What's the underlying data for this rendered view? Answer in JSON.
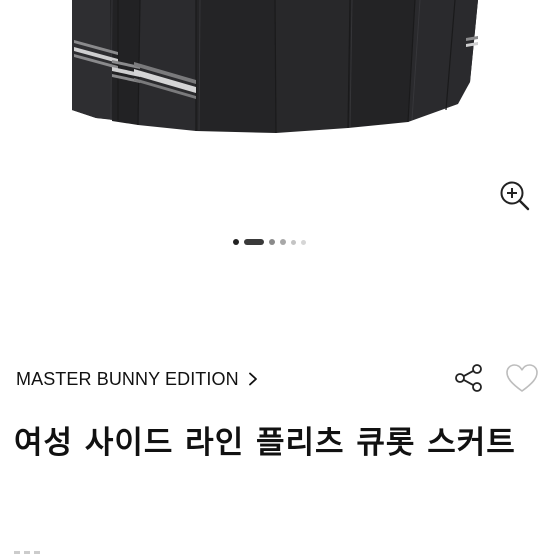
{
  "product": {
    "image_alt": "pleated skirt product photo",
    "carousel": {
      "total": 6,
      "active_index": 1
    },
    "zoom_icon": "zoom-in-icon",
    "brand": "MASTER BUNNY EDITION",
    "brand_chevron_icon": "chevron-right-icon",
    "share_icon": "share-icon",
    "like_icon": "heart-outline-icon",
    "title": "여성 사이드 라인 플리츠 큐롯 스커트"
  },
  "colors": {
    "skirt": "#2a2a2c",
    "stripe": "#c8c8c8",
    "text": "#111111",
    "dot_active": "#3a3a3a",
    "dot_inactive": "#cfcfcf"
  }
}
